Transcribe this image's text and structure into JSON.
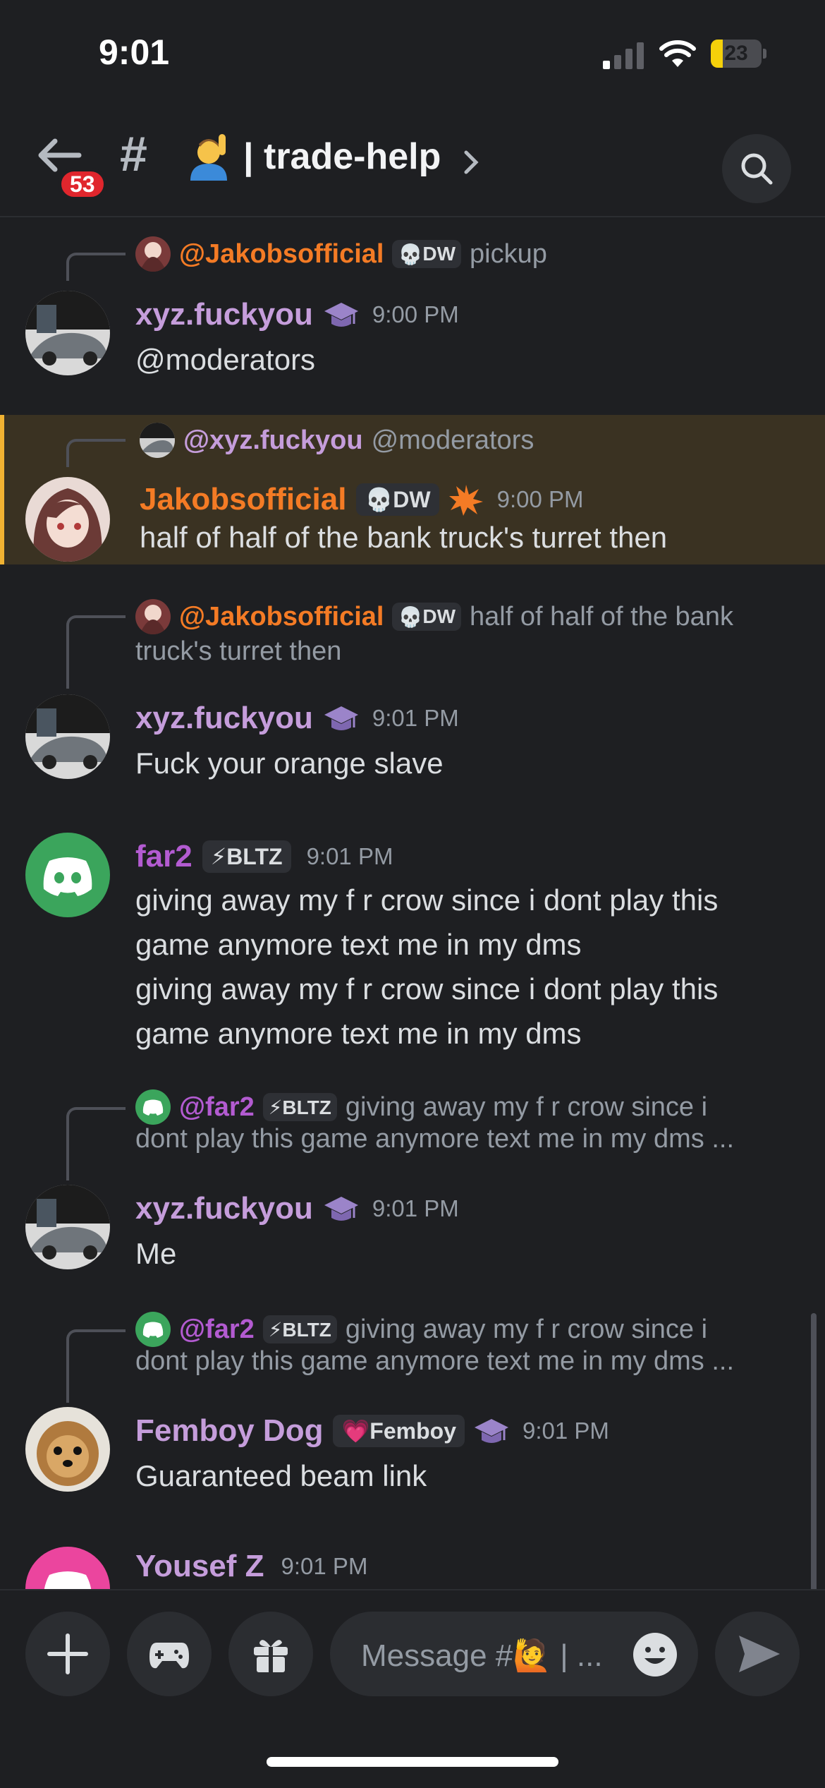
{
  "status_bar": {
    "time": "9:01",
    "battery": "23",
    "battery_level": 0.23
  },
  "header": {
    "unread_count": "53",
    "hash": "#",
    "channel_name": "| trade-help",
    "chevron": "›"
  },
  "colors": {
    "orange_user": "#f47b25",
    "purple_user": "#c59ddb",
    "bright_purple": "#b35bd1",
    "highlight_bar": "#f0b232",
    "mention_badge": "#e0262d"
  },
  "messages": [
    {
      "reply": {
        "name": "@Jakobsofficial",
        "tag": "DW",
        "tag_icon": "skull-icon",
        "text": "pickup"
      },
      "author": "xyz.fuckyou",
      "author_icon": "graduation-cap-icon",
      "time": "9:00 PM",
      "lines": [
        "@moderators"
      ]
    },
    {
      "reply": {
        "name": "@xyz.fuckyou",
        "text": "@moderators"
      },
      "author": "Jakobsofficial",
      "tag": "DW",
      "tag_icon": "skull-icon",
      "author_icon": "burst-icon",
      "time": "9:00 PM",
      "lines": [
        "half of half of the bank truck's turret then"
      ],
      "highlighted": true
    },
    {
      "reply": {
        "name": "@Jakobsofficial",
        "tag": "DW",
        "tag_icon": "skull-icon",
        "text": "half of half of the bank",
        "text2": "truck's turret then"
      },
      "author": "xyz.fuckyou",
      "author_icon": "graduation-cap-icon",
      "time": "9:01 PM",
      "lines": [
        "Fuck your orange slave"
      ]
    },
    {
      "author": "far2",
      "tag": "⚡BLTZ",
      "time": "9:01 PM",
      "lines": [
        "giving away my f r crow since i dont play this",
        "game anymore text me in my dms",
        "giving away my f r crow since i dont play this",
        "game anymore text me in my dms"
      ]
    },
    {
      "reply": {
        "name": "@far2",
        "tag": "⚡BLTZ",
        "text": "giving away my f r crow since i",
        "text2": "dont play this game anymore text me in my dms ..."
      },
      "author": "xyz.fuckyou",
      "author_icon": "graduation-cap-icon",
      "time": "9:01 PM",
      "lines": [
        "Me"
      ]
    },
    {
      "reply": {
        "name": "@far2",
        "tag": "⚡BLTZ",
        "text": "giving away my f r crow since i",
        "text2": "dont play this game anymore text me in my dms ..."
      },
      "author": "Femboy Dog",
      "tag": "💗Femboy",
      "author_icon": "graduation-cap-icon",
      "time": "9:01 PM",
      "lines": [
        "Guaranteed beam link"
      ]
    },
    {
      "author": "Yousef Z",
      "time": "9:01 PM",
      "lines": []
    }
  ],
  "composer": {
    "placeholder": "Message #🙋 | ..."
  }
}
